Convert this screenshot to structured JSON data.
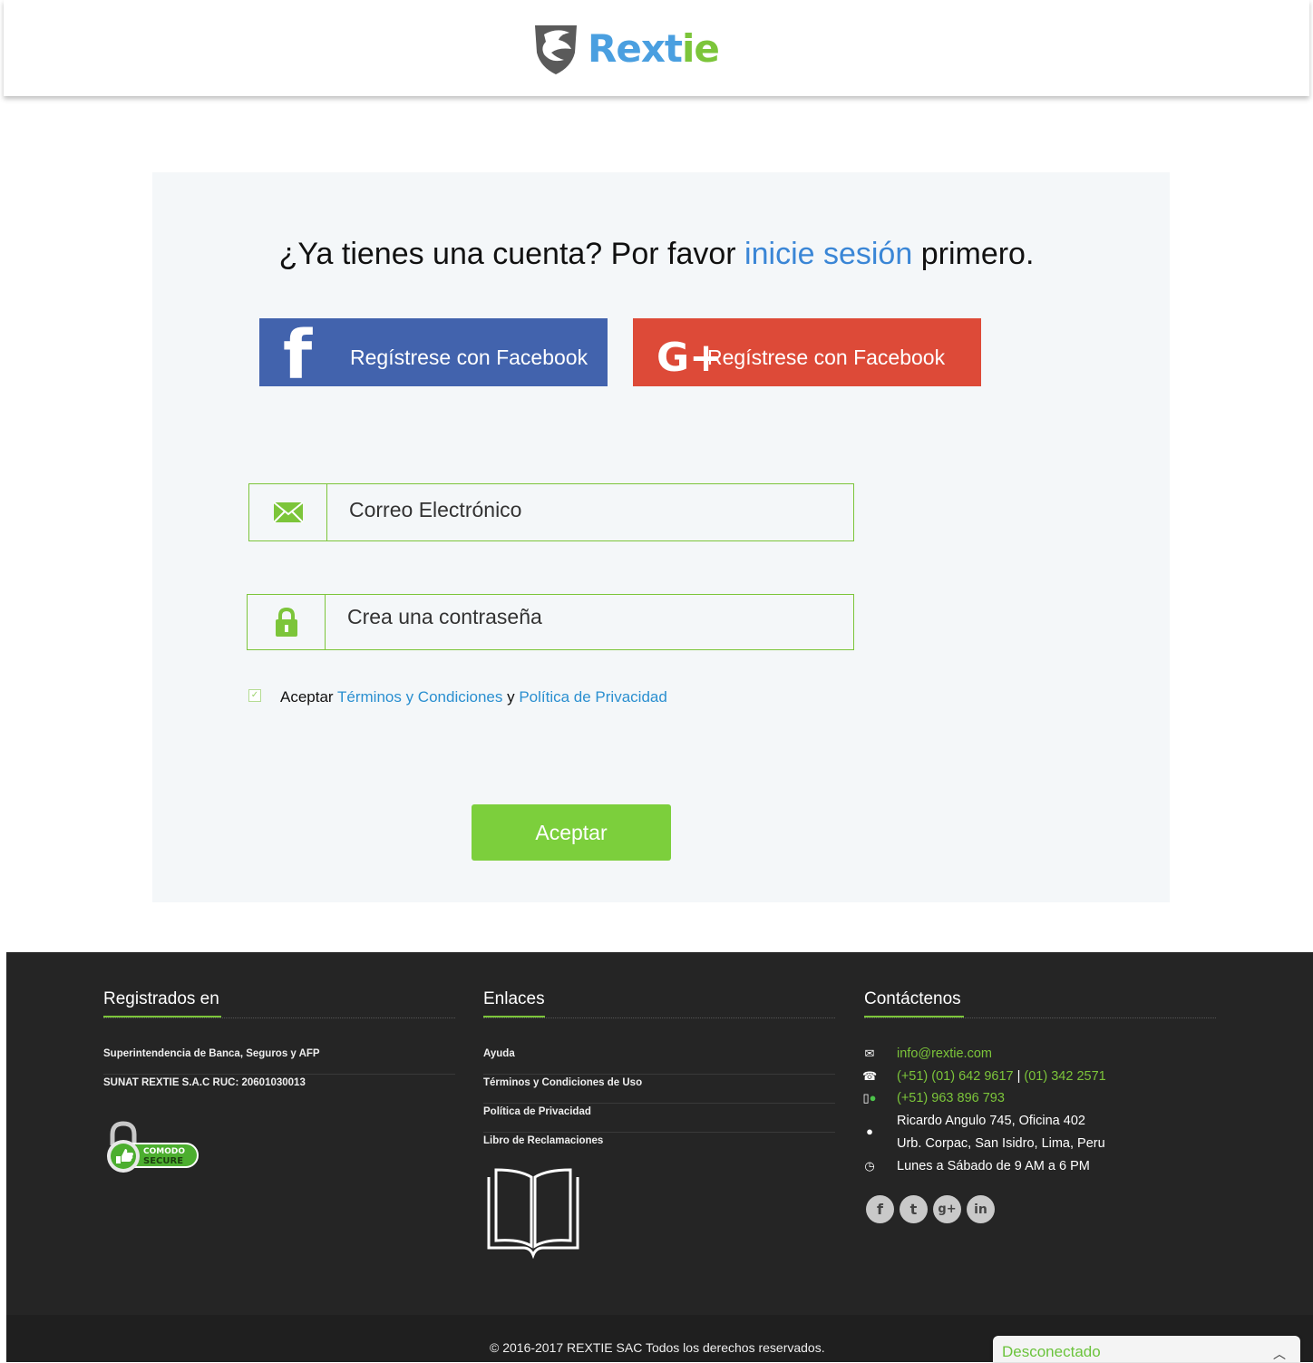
{
  "header": {
    "logo_text_main": "Rext",
    "logo_text_accent": "ie"
  },
  "card": {
    "headline_before": "¿Ya tienes una cuenta? Por favor ",
    "headline_link": "inicie sesión",
    "headline_after": " primero.",
    "facebook_button": {
      "icon": "facebook-icon",
      "label": "Regístrese con Facebook"
    },
    "google_button": {
      "icon": "google-plus-icon",
      "label": "Regístrese con Facebook"
    },
    "email": {
      "icon": "envelope-icon",
      "placeholder": "Correo Electrónico",
      "value": ""
    },
    "password": {
      "icon": "padlock-icon",
      "placeholder": "Crea una contraseña",
      "value": ""
    },
    "terms": {
      "checked": true,
      "prefix": "Aceptar ",
      "terms_link": "Términos y Condiciones",
      "joiner": " y ",
      "privacy_link": "Política de Privacidad"
    },
    "submit_label": "Aceptar"
  },
  "footer": {
    "registered": {
      "title": "Registrados en",
      "items": [
        "Superintendencia de Banca, Seguros y AFP",
        "SUNAT REXTIE S.A.C RUC: 20601030013"
      ],
      "badge_top": "COMODO",
      "badge_bottom": "SECURE"
    },
    "links": {
      "title": "Enlaces",
      "items": [
        "Ayuda",
        "Términos y Condiciones de Uso",
        "Política de Privacidad",
        "Libro de Reclamaciones"
      ]
    },
    "contact": {
      "title": "Contáctenos",
      "email": "info@rextie.com",
      "phone_1": "(+51) (01) 642 9617",
      "phone_separator": " | ",
      "phone_2": "(01) 342 2571",
      "mobile": "(+51) 963 896 793",
      "address_1": "Ricardo Angulo 745, Oficina 402",
      "address_2": "Urb. Corpac, San Isidro, Lima, Peru",
      "hours": "Lunes a Sábado de 9 AM a 6 PM",
      "socials": [
        "facebook-icon",
        "twitter-icon",
        "google-plus-icon",
        "linkedin-icon"
      ]
    },
    "copyright": "2016-2017 REXTIE SAC Todos los derechos reservados."
  },
  "chat": {
    "status": "Desconectado"
  },
  "colors": {
    "brand_blue": "#4a9fe0",
    "brand_green": "#7cc53a",
    "facebook": "#4263ad",
    "google": "#dd4a38"
  }
}
